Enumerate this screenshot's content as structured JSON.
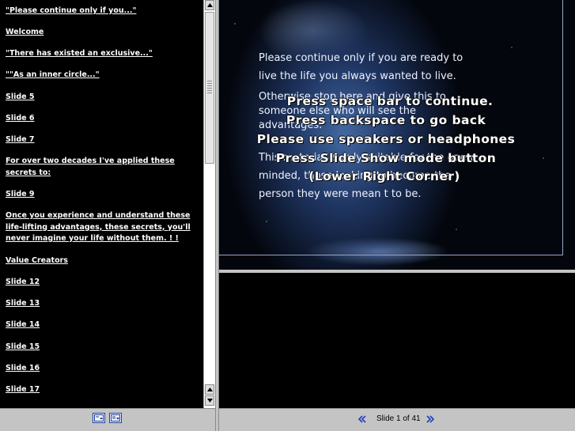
{
  "outline": {
    "items": [
      {
        "label": "\"Please continue only if you...\""
      },
      {
        "label": "Welcome"
      },
      {
        "label": "\"There has existed an exclusive...\""
      },
      {
        "label": "\"\"As an inner circle...\""
      },
      {
        "label": "Slide 5"
      },
      {
        "label": "Slide 6"
      },
      {
        "label": "Slide 7"
      },
      {
        "label": "For over two decades I've applied these secrets to:"
      },
      {
        "label": "Slide 9"
      },
      {
        "label": "Once you experience and understand these life-lifting advantages, these secrets, you'll never imagine your life without them.  ! !"
      },
      {
        "label": "Value Creators"
      },
      {
        "label": "Slide 12"
      },
      {
        "label": "Slide 13"
      },
      {
        "label": "Slide 14"
      },
      {
        "label": "Slide 15"
      },
      {
        "label": "Slide 16"
      },
      {
        "label": "Slide 17"
      }
    ]
  },
  "slide": {
    "paragraphs": [
      "Please continue only if you are ready to live the life you always wanted to live.",
      "Otherwise stop here and give this to someone else who will see the advantages.",
      "This material is only suitable for the open minded, those looking to become the person they were mean t to be."
    ],
    "overlay_lines": [
      "Press space bar to continue.",
      "Press backspace to go back",
      "Please use speakers or headphones",
      "Press Slide Show mode button",
      "(Lower Right Corner)"
    ]
  },
  "nav": {
    "slide_counter": "Slide 1 of 41",
    "prev_icon": "double-chevron-left-icon",
    "next_icon": "double-chevron-right-icon"
  },
  "colors": {
    "nav_arrow": "#1f3fbf",
    "panel_gray": "#c4c4c4"
  }
}
